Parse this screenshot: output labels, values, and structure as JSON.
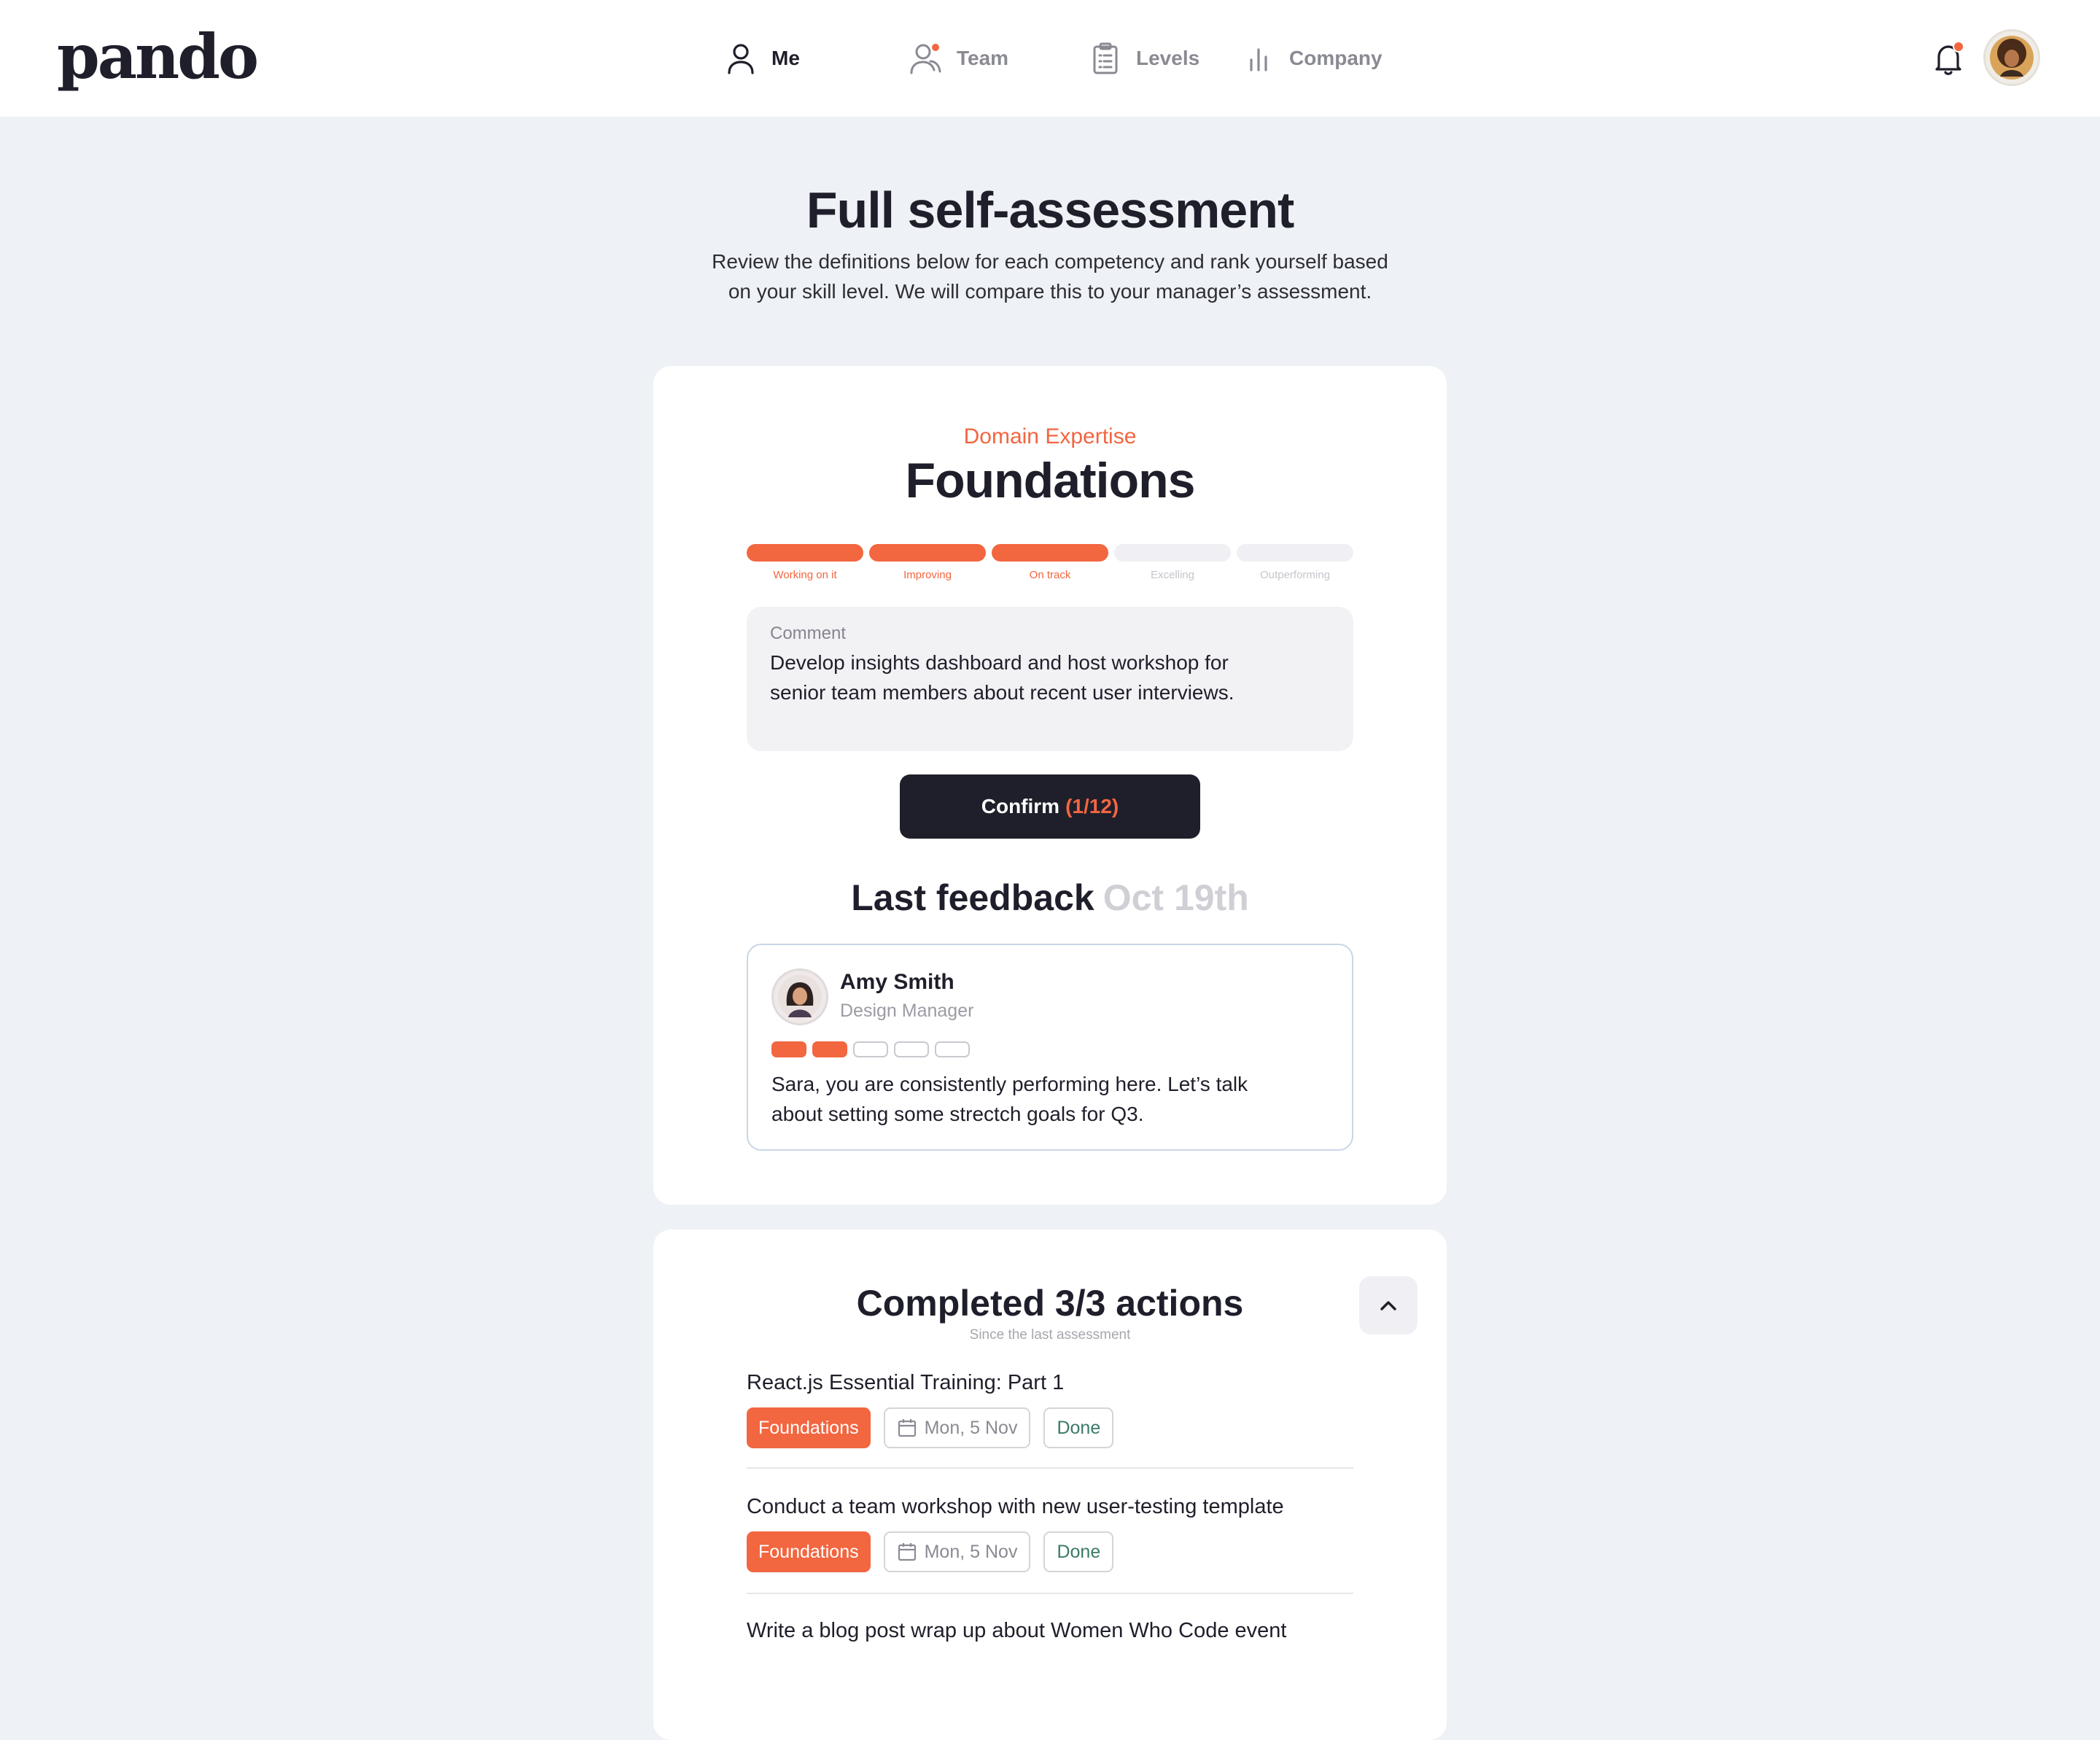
{
  "app": {
    "logo": "pando"
  },
  "nav": {
    "items": [
      {
        "label": "Me",
        "icon": "user-icon",
        "active": true,
        "badge": false
      },
      {
        "label": "Team",
        "icon": "team-icon",
        "active": false,
        "badge": true
      },
      {
        "label": "Levels",
        "icon": "clipboard-icon",
        "active": false,
        "badge": false
      },
      {
        "label": "Company",
        "icon": "bar-chart-icon",
        "active": false,
        "badge": false
      }
    ],
    "notifications": {
      "icon": "bell-icon",
      "badge": true
    },
    "avatar": "user-avatar"
  },
  "header": {
    "title": "Full self-assessment",
    "subtitle_line1": "Review the definitions below for each competency and rank yourself based",
    "subtitle_line2": "on your skill level. We will compare this to your manager’s assessment."
  },
  "competency": {
    "category": "Domain Expertise",
    "title": "Foundations",
    "levels": [
      {
        "label": "Working on it",
        "selected": true
      },
      {
        "label": "Improving",
        "selected": true
      },
      {
        "label": "On track",
        "selected": true
      },
      {
        "label": "Excelling",
        "selected": false
      },
      {
        "label": "Outperforming",
        "selected": false
      }
    ],
    "comment": {
      "label": "Comment",
      "line1": "Develop insights dashboard and host workshop for",
      "line2": "senior team members about recent user interviews."
    },
    "confirm": {
      "label": "Confirm",
      "count": "(1/12)"
    }
  },
  "feedback": {
    "heading": "Last feedback",
    "date": "Oct 19th",
    "author": {
      "name": "Amy Smith",
      "role": "Design Manager"
    },
    "rating": 2,
    "rating_max": 5,
    "line1": "Sara, you are consistently performing here. Let’s talk",
    "line2": "about setting some strectch goals for Q3."
  },
  "actions": {
    "title": "Completed 3/3 actions",
    "subtitle": "Since the last assessment",
    "items": [
      {
        "title": "React.js Essential Training: Part 1",
        "category": "Foundations",
        "date": "Mon, 5 Nov",
        "status": "Done"
      },
      {
        "title": "Conduct a team workshop with new user-testing template",
        "category": "Foundations",
        "date": "Mon, 5 Nov",
        "status": "Done"
      },
      {
        "title": "Write a blog post wrap up about Women Who Code event"
      }
    ]
  },
  "colors": {
    "accent": "#f26640",
    "dark": "#1f1f2b",
    "background": "#eef1f5"
  }
}
